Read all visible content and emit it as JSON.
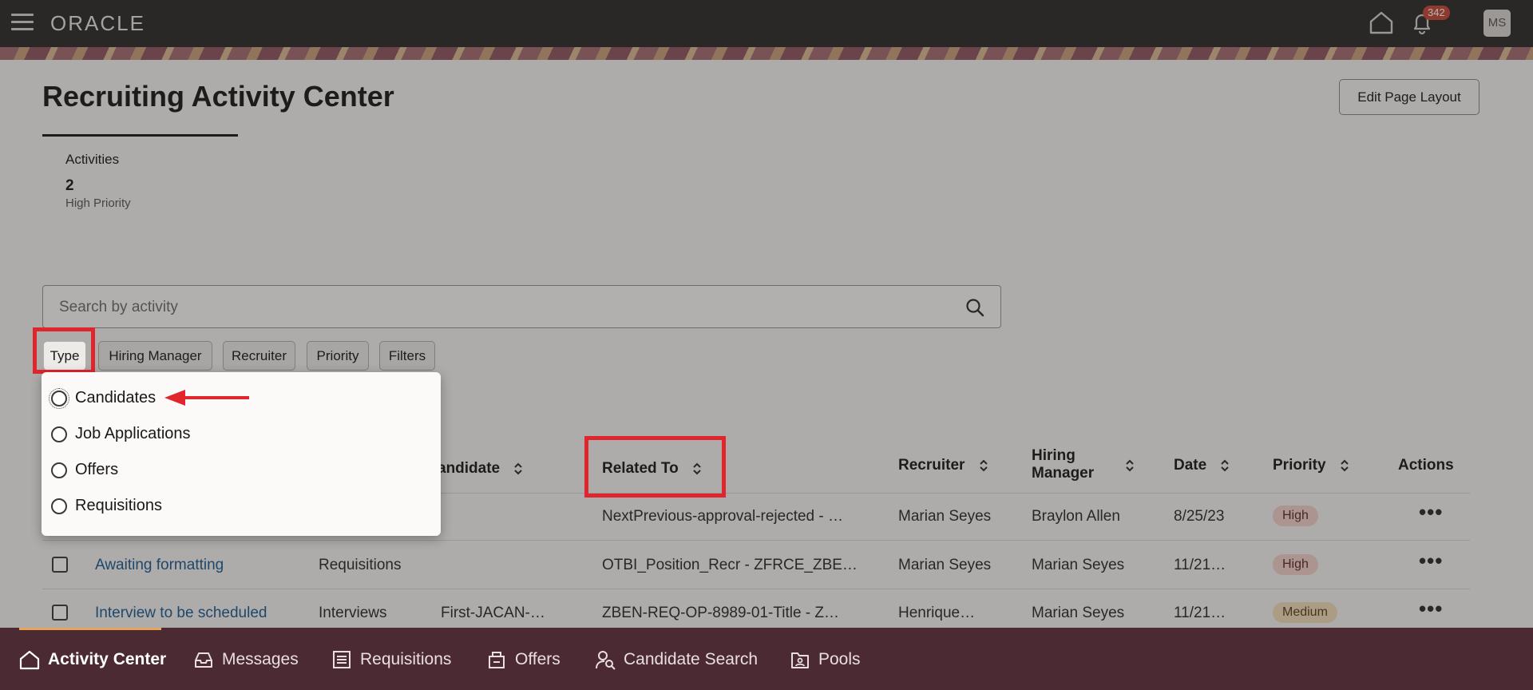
{
  "topbar": {
    "logo": "ORACLE",
    "notification_count": "342",
    "avatar_initials": "MS"
  },
  "page": {
    "title": "Recruiting Activity Center",
    "edit_layout_label": "Edit Page Layout"
  },
  "summary": {
    "label": "Activities",
    "count": "2",
    "caption": "High Priority"
  },
  "search": {
    "placeholder": "Search by activity"
  },
  "filter_chips": [
    "Type",
    "Hiring Manager",
    "Recruiter",
    "Priority",
    "Filters"
  ],
  "type_dropdown": {
    "options": [
      "Candidates",
      "Job Applications",
      "Offers",
      "Requisitions"
    ]
  },
  "table": {
    "headers": {
      "candidate": "andidate",
      "related_to": "Related To",
      "recruiter": "Recruiter",
      "hiring_manager": "Hiring Manager",
      "date": "Date",
      "priority": "Priority",
      "actions": "Actions"
    },
    "rows": [
      {
        "activity": "",
        "type": "",
        "candidate": "",
        "related_to": "NextPrevious-approval-rejected - …",
        "recruiter": "Marian Seyes",
        "hiring_manager": "Braylon Allen",
        "date": "8/25/23",
        "priority": "High"
      },
      {
        "activity": "Awaiting formatting",
        "type": "Requisitions",
        "candidate": "",
        "related_to": "OTBI_Position_Recr - ZFRCE_ZBE…",
        "recruiter": "Marian Seyes",
        "hiring_manager": "Marian Seyes",
        "date": "11/21…",
        "priority": "High"
      },
      {
        "activity": "Interview to be scheduled",
        "type": "Interviews",
        "candidate": "First-JACAN-…",
        "related_to": "ZBEN-REQ-OP-8989-01-Title - Z…",
        "recruiter": "Henrique…",
        "hiring_manager": "Marian Seyes",
        "date": "11/21…",
        "priority": "Medium"
      }
    ],
    "more_actions_glyph": "•••"
  },
  "bottom_nav": {
    "items": [
      "Activity Center",
      "Messages",
      "Requisitions",
      "Offers",
      "Candidate Search",
      "Pools"
    ]
  },
  "colors": {
    "accent_red": "#e0262c",
    "nav_bg": "#4c2a34",
    "topbar_bg": "#2c2a28",
    "link": "#1b5a8f"
  }
}
